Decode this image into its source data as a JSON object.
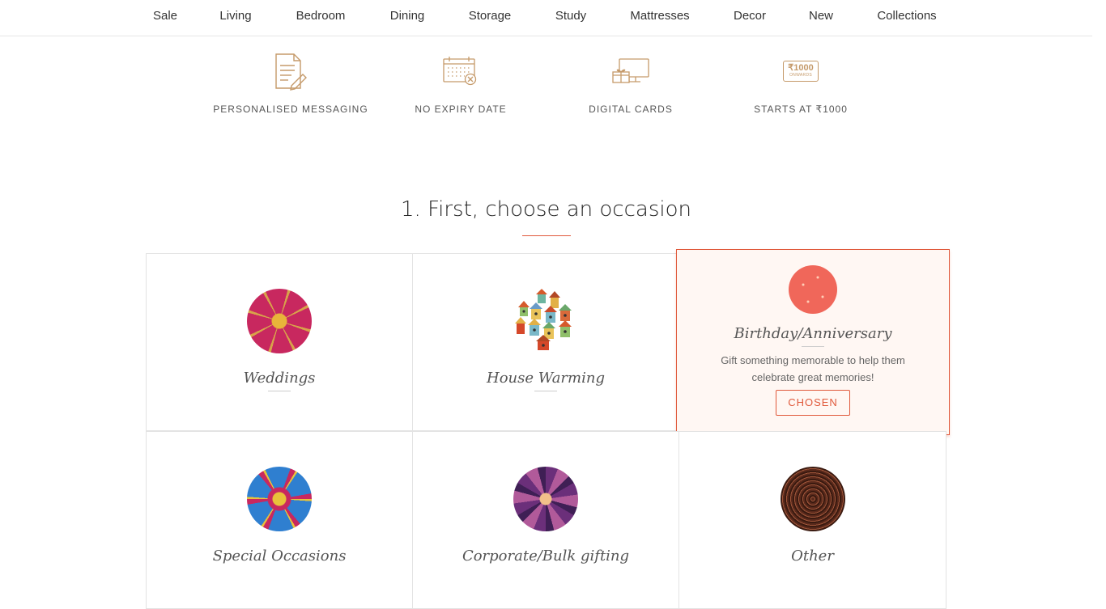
{
  "nav": {
    "items": [
      "Sale",
      "Living",
      "Bedroom",
      "Dining",
      "Storage",
      "Study",
      "Mattresses",
      "Decor",
      "New",
      "Collections"
    ]
  },
  "features": [
    {
      "label": "PERSONALISED MESSAGING",
      "icon": "message-document-icon"
    },
    {
      "label": "NO EXPIRY DATE",
      "icon": "calendar-no-expiry-icon"
    },
    {
      "label": "DIGITAL CARDS",
      "icon": "digital-card-gift-icon"
    },
    {
      "label": "STARTS AT ₹1000",
      "icon": "price-tag-1000-icon",
      "icon_text": "₹1000",
      "icon_subtext": "ONWARDS"
    }
  ],
  "section": {
    "title": "1. First, choose an occasion"
  },
  "occasions": [
    {
      "name": "Weddings"
    },
    {
      "name": "House Warming"
    },
    {
      "name": "Birthday/Anniversary",
      "description": "Gift something memorable to help them celebrate great memories!",
      "button": "CHOSEN",
      "chosen": true
    },
    {
      "name": "Special Occasions"
    },
    {
      "name": "Corporate/Bulk gifting"
    },
    {
      "name": "Other"
    }
  ],
  "colors": {
    "accent": "#e0593b",
    "icon": "#c59a6a",
    "chosen_bg": "#fff7f3"
  }
}
